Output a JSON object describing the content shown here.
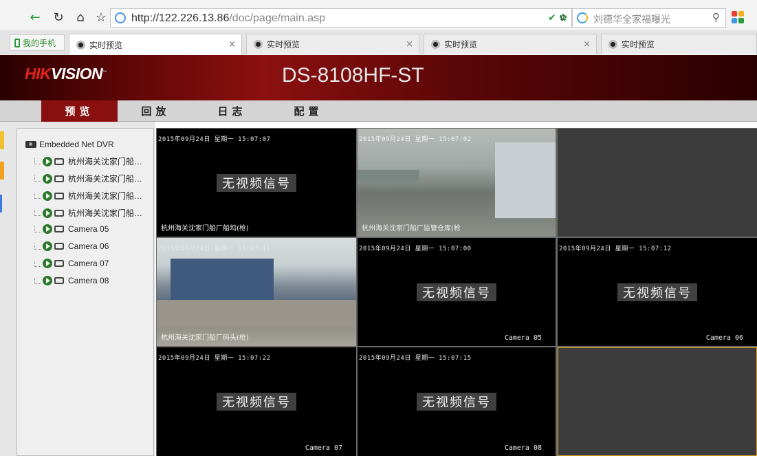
{
  "browser": {
    "url_prefix": "http://122.226.13.86",
    "url_path": "/doc/page/main.asp",
    "search_placeholder": "刘德华全家福曝光",
    "bookmark_label": "我的手机",
    "tabs": [
      {
        "title": "实时预览",
        "active": true
      },
      {
        "title": "实时预览",
        "active": false
      },
      {
        "title": "实时预览",
        "active": false
      },
      {
        "title": "实时预览",
        "active": false
      }
    ],
    "close_glyph": "×"
  },
  "header": {
    "logo_red": "HIK",
    "logo_white": "VISION",
    "logo_tm": "™",
    "model": "DS-8108HF-ST"
  },
  "menu": [
    "预览",
    "回放",
    "日志",
    "配置"
  ],
  "device_tree": {
    "root": "Embedded Net DVR",
    "cameras": [
      "杭州海关沈家门船…",
      "杭州海关沈家门船…",
      "杭州海关沈家门船…",
      "杭州海关沈家门船…",
      "Camera 05",
      "Camera 06",
      "Camera 07",
      "Camera 08"
    ]
  },
  "video": {
    "no_signal": "无视频信号",
    "cells": [
      {
        "timestamp": "2015年09月24日  星期一  15:07:07",
        "label": "杭州海关沈家门船厂船坞(枪)",
        "state": "nosignal"
      },
      {
        "timestamp": "2015年09月24日  星期一  15:07:02",
        "label": "杭州海关沈家门船厂监管仓库(枪",
        "state": "live"
      },
      {
        "timestamp": "",
        "label": "",
        "state": "empty"
      },
      {
        "timestamp": "2015年09月24日  星期一  15:07:11",
        "label": "杭州海关沈家门船厂码头(枪)",
        "state": "live"
      },
      {
        "timestamp": "2015年09月24日  星期一  15:07:00",
        "label": "Camera 05",
        "state": "nosignal"
      },
      {
        "timestamp": "2015年09月24日  星期一  15:07:12",
        "label": "Camera 06",
        "state": "nosignal"
      },
      {
        "timestamp": "2015年09月24日  星期一  15:07:22",
        "label": "Camera 07",
        "state": "nosignal"
      },
      {
        "timestamp": "2015年09月24日  星期一  15:07:15",
        "label": "Camera 08",
        "state": "nosignal"
      },
      {
        "timestamp": "",
        "label": "",
        "state": "selected-empty"
      }
    ]
  }
}
